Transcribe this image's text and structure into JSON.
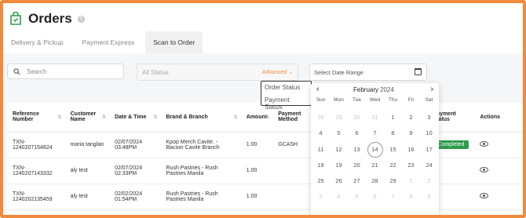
{
  "page": {
    "title": "Orders"
  },
  "tabs": [
    {
      "label": "Delivery & Pickup"
    },
    {
      "label": "Payment Express"
    },
    {
      "label": "Scan to Order"
    }
  ],
  "filters": {
    "search_placeholder": "Search",
    "status_placeholder": "All Status",
    "advanced_label": "Advanced",
    "date_placeholder": "Select Date Range"
  },
  "advanced_menu": [
    "Order Status",
    "Payment Status"
  ],
  "datepicker": {
    "month": "February",
    "year": "2024",
    "weekdays": [
      "Sun",
      "Mon",
      "Tue",
      "Wed",
      "Thu",
      "Fri",
      "Sat"
    ],
    "days": [
      {
        "d": "28",
        "m": true
      },
      {
        "d": "29",
        "m": true
      },
      {
        "d": "30",
        "m": true
      },
      {
        "d": "31",
        "m": true
      },
      {
        "d": "1"
      },
      {
        "d": "2"
      },
      {
        "d": "3"
      },
      {
        "d": "4"
      },
      {
        "d": "5"
      },
      {
        "d": "6"
      },
      {
        "d": "7"
      },
      {
        "d": "8"
      },
      {
        "d": "9"
      },
      {
        "d": "10"
      },
      {
        "d": "11"
      },
      {
        "d": "12"
      },
      {
        "d": "13"
      },
      {
        "d": "14",
        "today": true
      },
      {
        "d": "15"
      },
      {
        "d": "16"
      },
      {
        "d": "17"
      },
      {
        "d": "18"
      },
      {
        "d": "19"
      },
      {
        "d": "20"
      },
      {
        "d": "21"
      },
      {
        "d": "22"
      },
      {
        "d": "23"
      },
      {
        "d": "24"
      },
      {
        "d": "25"
      },
      {
        "d": "26"
      },
      {
        "d": "27"
      },
      {
        "d": "28"
      },
      {
        "d": "29"
      },
      {
        "d": "1",
        "m": true
      },
      {
        "d": "2",
        "m": true
      },
      {
        "d": "3",
        "m": true
      },
      {
        "d": "4",
        "m": true
      },
      {
        "d": "5",
        "m": true
      },
      {
        "d": "6",
        "m": true
      },
      {
        "d": "7",
        "m": true
      },
      {
        "d": "8",
        "m": true
      },
      {
        "d": "9",
        "m": true
      }
    ]
  },
  "table": {
    "headers": {
      "ref": "Reference Number",
      "customer": "Customer Name",
      "datetime": "Date & Time",
      "brand": "Brand & Branch",
      "amount": "Amount",
      "payment_method": "Payment Method",
      "payment_status": "Payment Status",
      "actions": "Actions"
    },
    "rows": [
      {
        "ref": "TXN-1240207154824",
        "customer": "maria tanglao",
        "date": "02/07/2024",
        "time": "03:48PM",
        "brand": "Kpop Merch Cavite. - Bacoor Cavite Branch",
        "amount": "1.00",
        "method": "GCASH",
        "status": "Completed"
      },
      {
        "ref": "TXN-1240207143332",
        "customer": "aly test",
        "date": "02/07/2024",
        "time": "02:33PM",
        "brand": "Rush Pastries - Rush Pastries Manila",
        "amount": "1.00",
        "method": "",
        "status": ""
      },
      {
        "ref": "TXN-1240202135459",
        "customer": "aly test",
        "date": "02/02/2024",
        "time": "01:54PM",
        "brand": "Rush Pastries - Rush Pastries Manila",
        "amount": "1.00",
        "method": "",
        "status": ""
      }
    ]
  },
  "colors": {
    "accent": "#f08a3c",
    "success": "#2e9b48"
  }
}
